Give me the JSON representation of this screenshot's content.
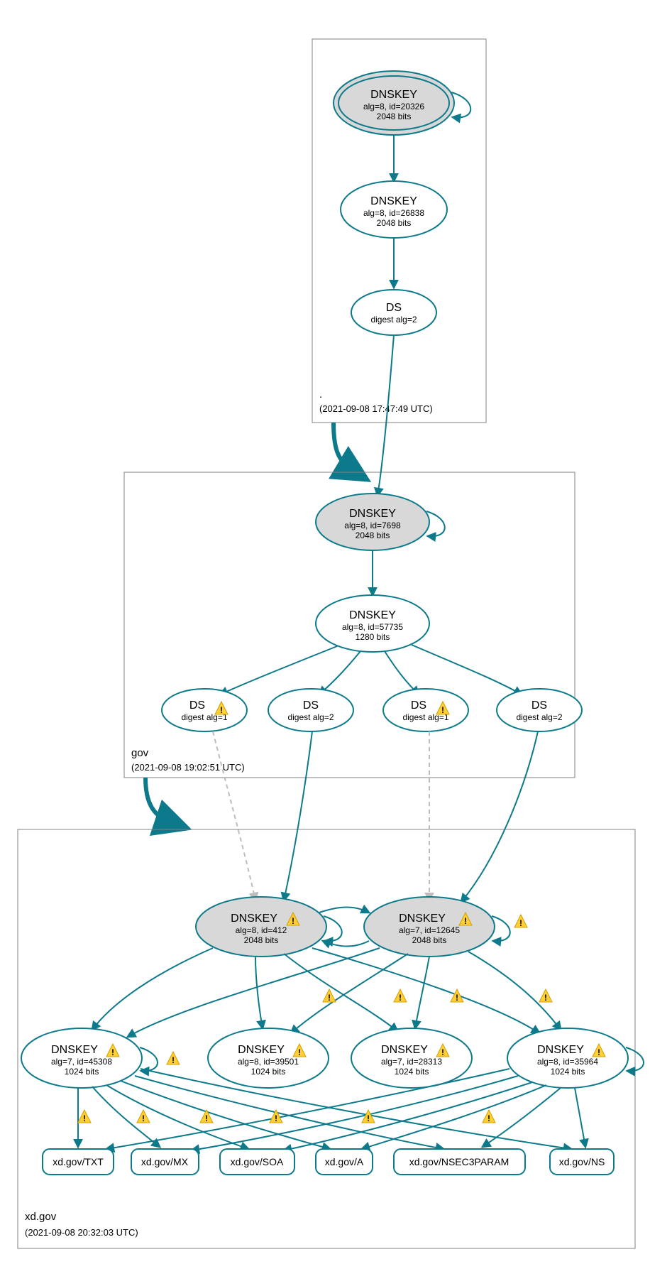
{
  "zones": {
    "root": {
      "name": ".",
      "time": "(2021-09-08 17:47:49 UTC)"
    },
    "gov": {
      "name": "gov",
      "time": "(2021-09-08 19:02:51 UTC)"
    },
    "xd": {
      "name": "xd.gov",
      "time": "(2021-09-08 20:32:03 UTC)"
    }
  },
  "nodes": {
    "root_ksk": {
      "l1": "DNSKEY",
      "l2": "alg=8, id=20326",
      "l3": "2048 bits"
    },
    "root_zsk": {
      "l1": "DNSKEY",
      "l2": "alg=8, id=26838",
      "l3": "2048 bits"
    },
    "root_ds": {
      "l1": "DS",
      "l2": "digest alg=2"
    },
    "gov_ksk": {
      "l1": "DNSKEY",
      "l2": "alg=8, id=7698",
      "l3": "2048 bits"
    },
    "gov_zsk": {
      "l1": "DNSKEY",
      "l2": "alg=8, id=57735",
      "l3": "1280 bits"
    },
    "gov_ds1": {
      "l1": "DS",
      "l2": "digest alg=1"
    },
    "gov_ds2": {
      "l1": "DS",
      "l2": "digest alg=2"
    },
    "gov_ds3": {
      "l1": "DS",
      "l2": "digest alg=1"
    },
    "gov_ds4": {
      "l1": "DS",
      "l2": "digest alg=2"
    },
    "xd_k412": {
      "l1": "DNSKEY",
      "l2": "alg=8, id=412",
      "l3": "2048 bits"
    },
    "xd_k12645": {
      "l1": "DNSKEY",
      "l2": "alg=7, id=12645",
      "l3": "2048 bits"
    },
    "xd_k45308": {
      "l1": "DNSKEY",
      "l2": "alg=7, id=45308",
      "l3": "1024 bits"
    },
    "xd_k39501": {
      "l1": "DNSKEY",
      "l2": "alg=8, id=39501",
      "l3": "1024 bits"
    },
    "xd_k28313": {
      "l1": "DNSKEY",
      "l2": "alg=7, id=28313",
      "l3": "1024 bits"
    },
    "xd_k35964": {
      "l1": "DNSKEY",
      "l2": "alg=8, id=35964",
      "l3": "1024 bits"
    }
  },
  "rr": {
    "txt": "xd.gov/TXT",
    "mx": "xd.gov/MX",
    "soa": "xd.gov/SOA",
    "a": "xd.gov/A",
    "nsec3": "xd.gov/NSEC3PARAM",
    "ns": "xd.gov/NS"
  }
}
